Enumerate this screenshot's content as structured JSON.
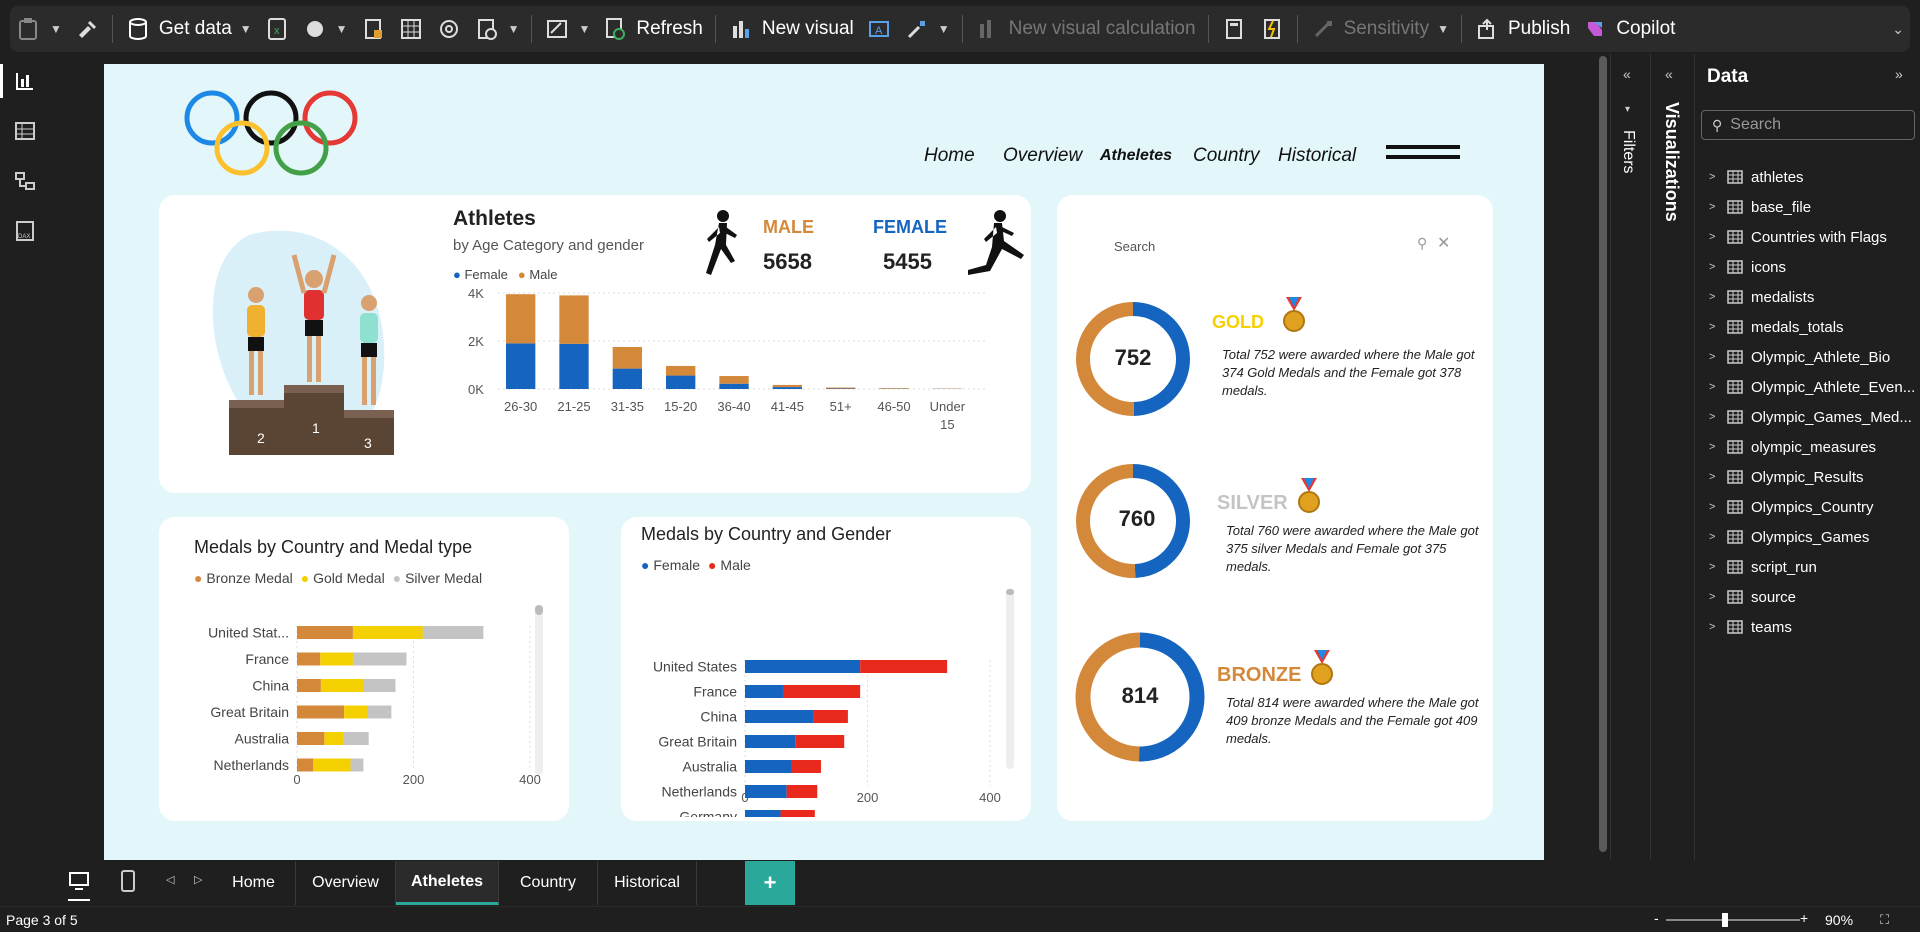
{
  "ribbon": {
    "get_data": "Get data",
    "refresh": "Refresh",
    "new_visual": "New visual",
    "new_visual_calc": "New visual calculation",
    "sensitivity": "Sensitivity",
    "publish": "Publish",
    "copilot": "Copilot"
  },
  "nav": {
    "home": "Home",
    "overview": "Overview",
    "athletes": "Atheletes",
    "country": "Country",
    "historical": "Historical"
  },
  "podium": {
    "first": "1",
    "second": "2",
    "third": "3"
  },
  "athletes_card": {
    "title": "Athletes",
    "subtitle": "by Age Category and gender",
    "male_label": "MALE",
    "male_value": "5658",
    "female_label": "FEMALE",
    "female_value": "5455"
  },
  "chart_data": [
    {
      "type": "bar",
      "stacked": true,
      "title": "Athletes",
      "subtitle": "by Age Category and gender",
      "categories": [
        "26-30",
        "21-25",
        "31-35",
        "15-20",
        "36-40",
        "41-45",
        "51+",
        "46-50",
        "Under 15"
      ],
      "series": [
        {
          "name": "Female",
          "color": "#1565c0",
          "values": [
            1900,
            1880,
            850,
            560,
            220,
            80,
            20,
            12,
            10
          ]
        },
        {
          "name": "Male",
          "color": "#d4883a",
          "values": [
            2050,
            2020,
            900,
            400,
            320,
            90,
            40,
            25,
            12
          ]
        }
      ],
      "yticks": [
        "0K",
        "2K",
        "4K"
      ],
      "ylim": [
        0,
        4000
      ],
      "legend": "top-left",
      "grid": true
    },
    {
      "type": "bar",
      "orientation": "horizontal",
      "stacked": true,
      "title": "Medals by Country and Medal type",
      "categories": [
        "United Stat...",
        "France",
        "China",
        "Great Britain",
        "Australia",
        "Netherlands"
      ],
      "series": [
        {
          "name": "Bronze Medal",
          "color": "#d4883a",
          "values": [
            96,
            40,
            41,
            81,
            47,
            28
          ]
        },
        {
          "name": "Gold Medal",
          "color": "#f5d000",
          "values": [
            120,
            56,
            74,
            40,
            33,
            64
          ]
        },
        {
          "name": "Silver Medal",
          "color": "#c4c4c4",
          "values": [
            104,
            92,
            54,
            41,
            43,
            22
          ]
        }
      ],
      "xticks": [
        "0",
        "200",
        "400"
      ],
      "xlim": [
        0,
        400
      ],
      "legend": "top-left"
    },
    {
      "type": "bar",
      "orientation": "horizontal",
      "stacked": true,
      "title": "Medals by Country and Gender",
      "categories": [
        "United States",
        "France",
        "China",
        "Great Britain",
        "Australia",
        "Netherlands",
        "Germany"
      ],
      "series": [
        {
          "name": "Female",
          "color": "#1565c0",
          "values": [
            188,
            62,
            112,
            82,
            76,
            68,
            58
          ]
        },
        {
          "name": "Male",
          "color": "#e8291c",
          "values": [
            142,
            126,
            56,
            80,
            48,
            50,
            56
          ]
        }
      ],
      "xticks": [
        "0",
        "200",
        "400"
      ],
      "xlim": [
        0,
        400
      ],
      "legend": "top-left"
    },
    {
      "type": "pie",
      "title": "GOLD",
      "center_label": "752",
      "series": [
        {
          "name": "Male",
          "color": "#1565c0",
          "values": [
            374
          ]
        },
        {
          "name": "Female",
          "color": "#d4883a",
          "values": [
            378
          ]
        }
      ]
    },
    {
      "type": "pie",
      "title": "SILVER",
      "center_label": "760",
      "series": [
        {
          "name": "Male",
          "color": "#1565c0",
          "values": [
            375
          ]
        },
        {
          "name": "Female",
          "color": "#d4883a",
          "values": [
            385
          ]
        }
      ]
    },
    {
      "type": "pie",
      "title": "BRONZE",
      "center_label": "814",
      "series": [
        {
          "name": "Male",
          "color": "#1565c0",
          "values": [
            409
          ]
        },
        {
          "name": "Female",
          "color": "#d4883a",
          "values": [
            405
          ]
        }
      ]
    }
  ],
  "medals": {
    "search": "Search",
    "gold": {
      "label": "GOLD",
      "total": "752",
      "text": "Total 752 were awarded where the Male got 374 Gold Medals and the Female got 378 medals."
    },
    "silver": {
      "label": "SILVER",
      "total": "760",
      "text": "Total 760 were awarded where the Male got 375 silver Medals and Female got 375 medals."
    },
    "bronze": {
      "label": "BRONZE",
      "total": "814",
      "text": "Total 814 were awarded where the Male got 409 bronze Medals and the Female got 409 medals."
    }
  },
  "filters_label": "Filters",
  "visualizations_label": "Visualizations",
  "data_pane": {
    "title": "Data",
    "search_placeholder": "Search",
    "tables": [
      "athletes",
      "base_file",
      "Countries with Flags",
      "icons",
      "medalists",
      "medals_totals",
      "Olympic_Athlete_Bio",
      "Olympic_Athlete_Even...",
      "Olympic_Games_Med...",
      "olympic_measures",
      "Olympic_Results",
      "Olympics_Country",
      "Olympics_Games",
      "script_run",
      "source",
      "teams"
    ]
  },
  "page_tabs": [
    "Home",
    "Overview",
    "Atheletes",
    "Country",
    "Historical"
  ],
  "status": {
    "page": "Page 3 of 5",
    "zoom": "90%"
  },
  "colors": {
    "accent_tab": "#2aa89a",
    "blue": "#1565c0",
    "orange": "#d4883a",
    "gold": "#f5d000",
    "red": "#e8291c"
  }
}
